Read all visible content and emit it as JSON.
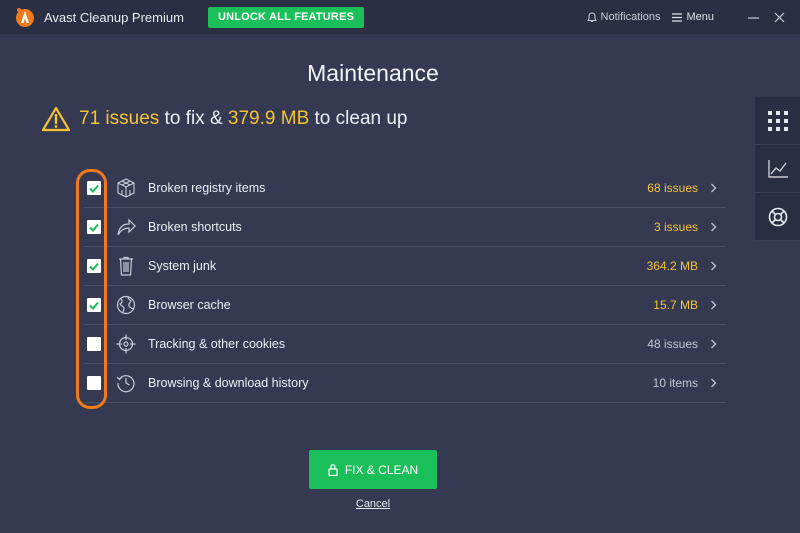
{
  "titlebar": {
    "app_title": "Avast Cleanup Premium",
    "unlock_label": "UNLOCK ALL FEATURES",
    "notifications_label": "Notifications",
    "menu_label": "Menu",
    "accent_color": "#1bbf5a"
  },
  "main": {
    "title": "Maintenance",
    "summary": {
      "issues_count": "71 issues",
      "to_fix": " to fix & ",
      "size": "379.9 MB",
      "to_clean": " to clean up"
    }
  },
  "items": [
    {
      "label": "Broken registry items",
      "value": "68 issues",
      "checked": true,
      "icon": "registry-cube-icon",
      "value_color": "#f6c333"
    },
    {
      "label": "Broken shortcuts",
      "value": "3 issues",
      "checked": true,
      "icon": "shortcut-arrow-icon",
      "value_color": "#f6c333"
    },
    {
      "label": "System junk",
      "value": "364.2 MB",
      "checked": true,
      "icon": "trash-icon",
      "value_color": "#f6c333"
    },
    {
      "label": "Browser cache",
      "value": "15.7 MB",
      "checked": true,
      "icon": "globe-icon",
      "value_color": "#f6c333"
    },
    {
      "label": "Tracking & other cookies",
      "value": "48 issues",
      "checked": false,
      "icon": "crosshair-icon",
      "value_color": "#c3c7d3"
    },
    {
      "label": "Browsing & download history",
      "value": "10 items",
      "checked": false,
      "icon": "history-icon",
      "value_color": "#c3c7d3"
    }
  ],
  "side_panel": [
    "grid-icon",
    "chart-icon",
    "lifebuoy-icon"
  ],
  "actions": {
    "fix_label": "FIX & CLEAN",
    "cancel_label": "Cancel"
  }
}
